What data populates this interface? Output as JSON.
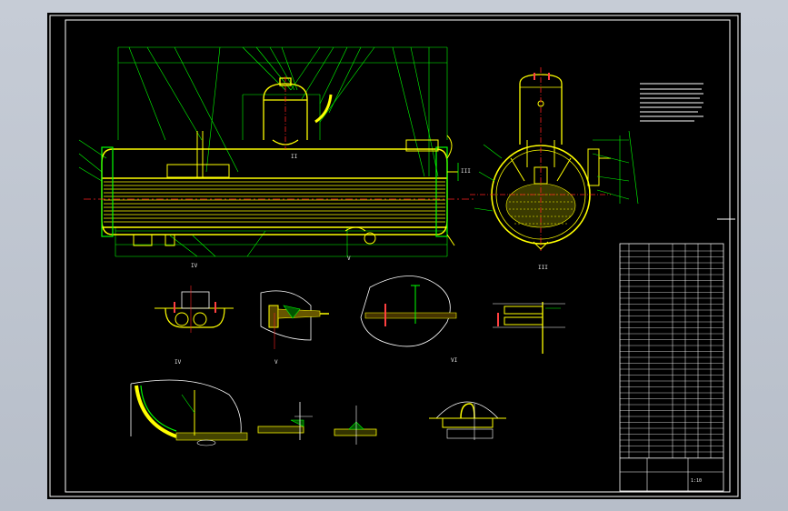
{
  "view_labels": {
    "section_ii": "II",
    "section_iii": "III",
    "detail_iv": "IV",
    "detail_v": "V",
    "detail_vi": "VI"
  },
  "title_block": {
    "scale": "1:10"
  },
  "colors": {
    "background": "#000000",
    "frame": "#ffffff",
    "outline": "#ffff00",
    "leader": "#00ff00",
    "centerline": "#ff2020",
    "dimension": "#00ffff",
    "hatch": "#ff00ff"
  }
}
